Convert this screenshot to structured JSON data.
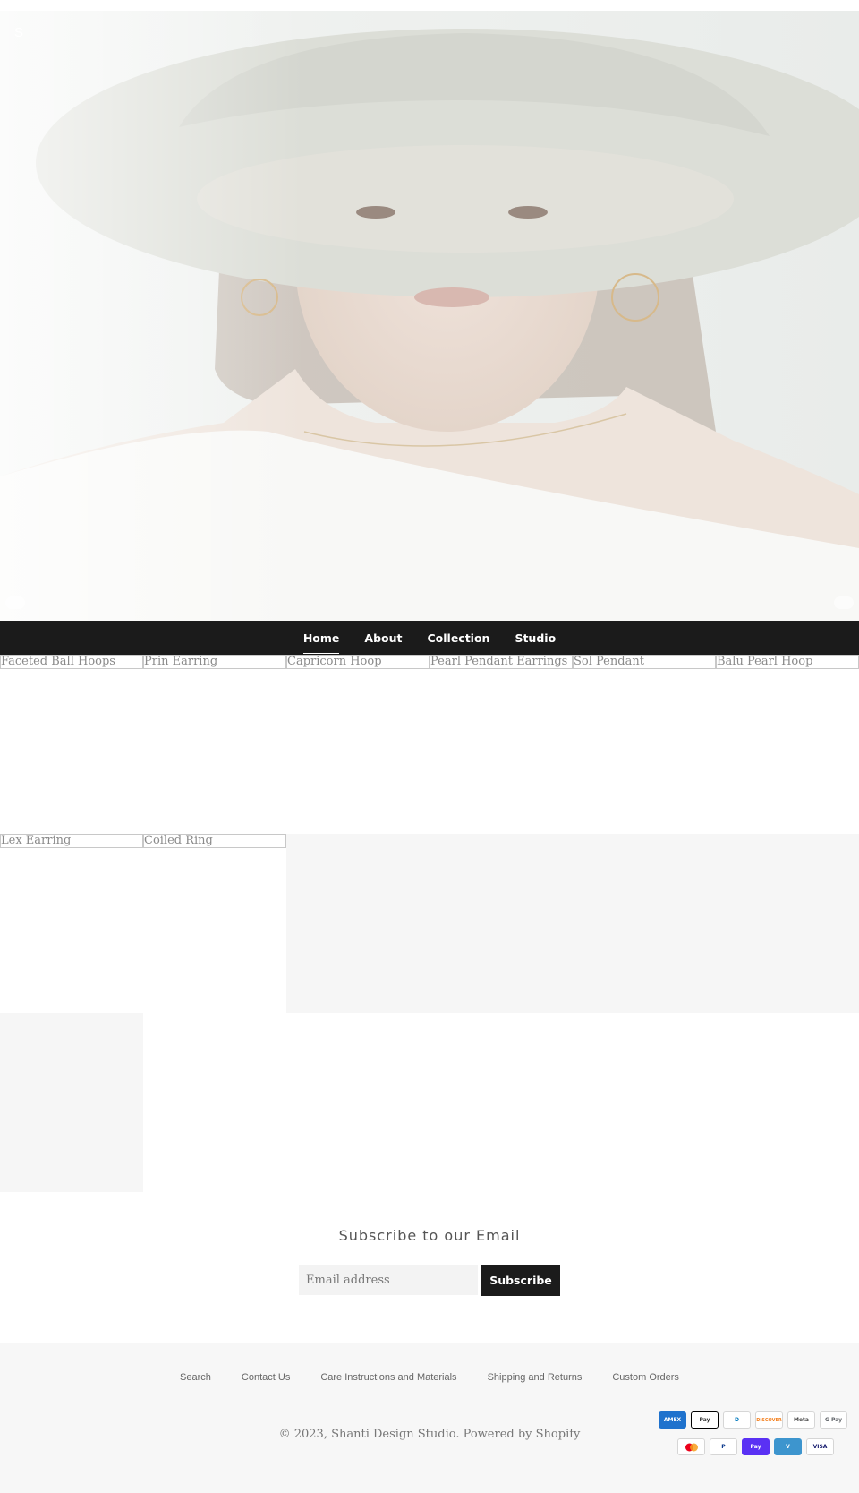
{
  "hero": {
    "logo_text": "S",
    "image_alt": "model-wearing-hat"
  },
  "nav": {
    "items": [
      {
        "label": "Home"
      },
      {
        "label": "About"
      },
      {
        "label": "Collection"
      },
      {
        "label": "Studio"
      }
    ]
  },
  "products": {
    "row1": [
      {
        "title": "Faceted Ball Hoops"
      },
      {
        "title": "Prin Earring"
      },
      {
        "title": "Capricorn Hoop"
      },
      {
        "title": "Pearl Pendant Earrings"
      },
      {
        "title": "Sol Pendant"
      },
      {
        "title": "Balu Pearl Hoop"
      }
    ],
    "row2": [
      {
        "title": "Lex Earring"
      },
      {
        "title": "Coiled Ring"
      }
    ]
  },
  "subscribe": {
    "heading": "Subscribe to our Email",
    "placeholder": "Email address",
    "button_label": "Subscribe"
  },
  "footer": {
    "links": [
      {
        "label": "Search"
      },
      {
        "label": "Contact Us"
      },
      {
        "label": "Care Instructions and Materials"
      },
      {
        "label": "Shipping and Returns"
      },
      {
        "label": "Custom Orders"
      }
    ],
    "copyright": "© 2023, Shanti Design Studio. Powered by Shopify",
    "payments_row1": [
      {
        "label": "AMEX",
        "icon": "amex-icon",
        "color": "#1f72cd"
      },
      {
        "label": "Pay",
        "icon": "apple-pay-icon",
        "color": "#000000"
      },
      {
        "label": "D",
        "icon": "diners-icon",
        "color": "#0079be"
      },
      {
        "label": "DISCOVER",
        "icon": "discover-icon",
        "color": "#f48120"
      },
      {
        "label": "Meta",
        "icon": "meta-pay-icon",
        "color": "#444444"
      },
      {
        "label": "G Pay",
        "icon": "google-pay-icon",
        "color": "#5f6368"
      }
    ],
    "payments_row2": [
      {
        "label": "",
        "icon": "mastercard-icon",
        "color": "#eb001b"
      },
      {
        "label": "P",
        "icon": "paypal-icon",
        "color": "#003087"
      },
      {
        "label": "Pay",
        "icon": "shop-pay-icon",
        "color": "#5a31f4"
      },
      {
        "label": "V",
        "icon": "venmo-icon",
        "color": "#3d95ce"
      },
      {
        "label": "VISA",
        "icon": "visa-icon",
        "color": "#1a1f71"
      }
    ]
  }
}
